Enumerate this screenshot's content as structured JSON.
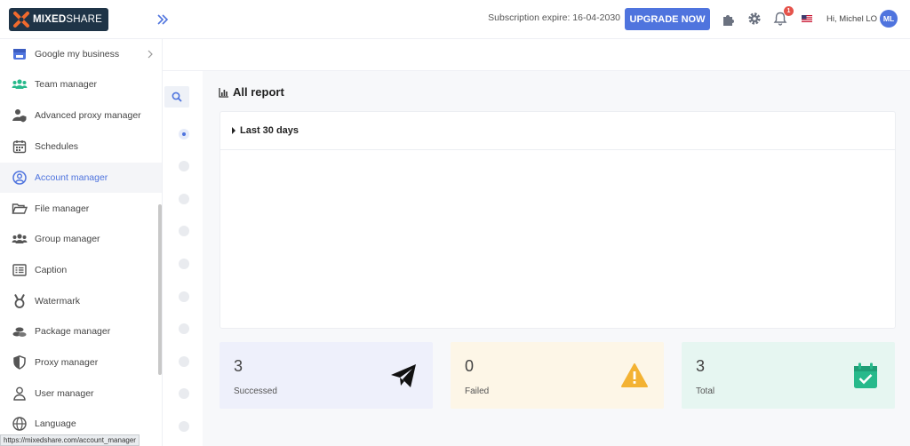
{
  "brand": {
    "name_bold": "MIXED",
    "name_light": "SHARE"
  },
  "header": {
    "subscription_text": "Subscription expire: 16-04-2030",
    "upgrade_label": "UPGRADE NOW",
    "notifications_count": "1",
    "greeting": "Hi, Michel LO",
    "avatar_initials": "ML"
  },
  "sidebar": {
    "items": [
      {
        "label": "Google my business",
        "icon": "store-icon"
      },
      {
        "label": "Team manager",
        "icon": "team-icon"
      },
      {
        "label": "Advanced proxy manager",
        "icon": "user-shield-icon"
      },
      {
        "label": "Schedules",
        "icon": "calendar-icon"
      },
      {
        "label": "Account manager",
        "icon": "user-circle-icon",
        "active": true
      },
      {
        "label": "File manager",
        "icon": "folder-open-icon"
      },
      {
        "label": "Group manager",
        "icon": "users-icon"
      },
      {
        "label": "Caption",
        "icon": "caption-icon"
      },
      {
        "label": "Watermark",
        "icon": "medal-icon"
      },
      {
        "label": "Package manager",
        "icon": "coins-icon"
      },
      {
        "label": "Proxy manager",
        "icon": "shield-icon"
      },
      {
        "label": "User manager",
        "icon": "user-icon"
      },
      {
        "label": "Language",
        "icon": "globe-icon"
      }
    ]
  },
  "main": {
    "title": "All report",
    "filter_label": "Last 30 days",
    "stats": [
      {
        "value": "3",
        "label": "Successed",
        "icon": "paper-plane-icon",
        "bg": "#eef0fb"
      },
      {
        "value": "0",
        "label": "Failed",
        "icon": "warning-icon",
        "bg": "#fdf6e7"
      },
      {
        "value": "3",
        "label": "Total",
        "icon": "calendar-check-icon",
        "bg": "#e6f6f1"
      }
    ]
  },
  "status_url": "https://mixedshare.com/account_manager",
  "colors": {
    "accent": "#4f74de",
    "warning": "#f3b233",
    "success": "#27b98b",
    "dark": "#1f3447"
  }
}
